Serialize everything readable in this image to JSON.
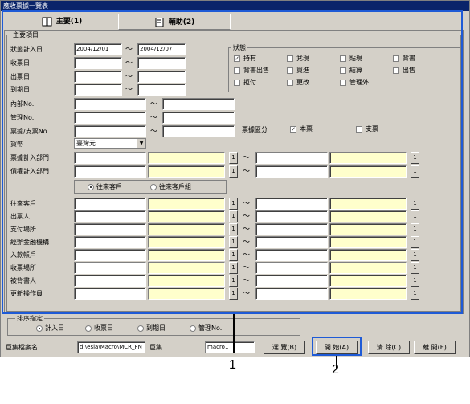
{
  "window": {
    "title": "應收票據一覽表"
  },
  "tabs": [
    {
      "label": "主要(1)"
    },
    {
      "label": "輔助(2)"
    }
  ],
  "main_group": {
    "title": "主要項目"
  },
  "date_rows": [
    {
      "label": "狀態計入日",
      "from": "2004/12/01",
      "to": "2004/12/07"
    },
    {
      "label": "收票日",
      "from": "",
      "to": ""
    },
    {
      "label": "出票日",
      "from": "",
      "to": ""
    },
    {
      "label": "到期日",
      "from": "",
      "to": ""
    }
  ],
  "status": {
    "title": "狀態",
    "items": [
      "持有",
      "兌現",
      "貼現",
      "背書",
      "背書出售",
      "買進",
      "結算",
      "出售",
      "拒付",
      "更改",
      "管理外"
    ],
    "checked": [
      true,
      false,
      false,
      false,
      false,
      false,
      false,
      false,
      false,
      false,
      false
    ]
  },
  "text_rows": [
    {
      "label": "內部No."
    },
    {
      "label": "管理No."
    },
    {
      "label": "票據/支票No."
    }
  ],
  "note_type": {
    "label": "票據區分",
    "opt1": "本票",
    "opt2": "支票"
  },
  "currency": {
    "label": "貨幣",
    "value": "臺灣元"
  },
  "dept_rows": [
    {
      "label": "票據計入部門"
    },
    {
      "label": "債權計入部門"
    }
  ],
  "partner_radio": {
    "opt1": "往來客戶",
    "opt2": "往來客戶組"
  },
  "partner_rows": [
    {
      "label": "往來客戶"
    },
    {
      "label": "出票人"
    },
    {
      "label": "支付場所"
    },
    {
      "label": "經辦金融機構"
    },
    {
      "label": "入款帳戶"
    },
    {
      "label": "收票場所"
    },
    {
      "label": "被背書人"
    },
    {
      "label": "更新操作員"
    }
  ],
  "sort": {
    "title": "排序指定",
    "options": [
      "計入日",
      "收票日",
      "到期日",
      "管理No."
    ]
  },
  "footer": {
    "macro_file_label": "巨集檔案名",
    "macro_file_value": "d:\\esia\\Macro\\MCR_FN",
    "macro_label": "巨集",
    "macro_value": "macro1",
    "browse": "選 覽(B)",
    "start": "開 始(A)",
    "clear": "清 除(C)",
    "close": "離 開(E)"
  },
  "callouts": {
    "one": "1",
    "two": "2"
  },
  "sb_char": "1",
  "tilde": "〜",
  "check_mark": "✓"
}
